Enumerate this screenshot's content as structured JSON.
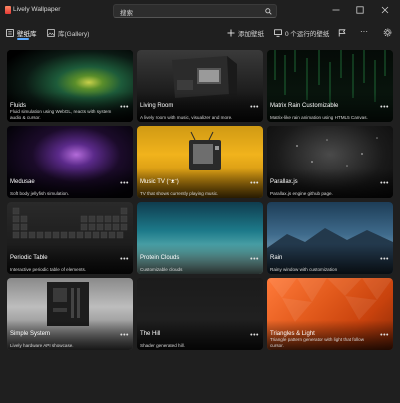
{
  "app": {
    "title": "Lively Wallpaper"
  },
  "search": {
    "value": "搜索"
  },
  "toolbar": {
    "tabs": [
      {
        "label": "壁纸库"
      },
      {
        "label": "库(Gallery)"
      }
    ],
    "add_label": "添加壁纸",
    "active_label": "0 个运行的壁纸"
  },
  "wallpapers": [
    {
      "title": "Fluids",
      "description": "Fluid simulation using WebGL, reacts with system audio & cursor.",
      "more": "•••"
    },
    {
      "title": "Living Room",
      "description": "A lively room with music, visualizer and more.",
      "more": "•••"
    },
    {
      "title": "Matrix Rain Customizable",
      "description": "Matrix-like rain animation using HTML5 Canvas.",
      "more": "•••"
    },
    {
      "title": "Medusae",
      "description": "Soft body jellyfish simulation.",
      "more": "•••"
    },
    {
      "title": "Music TV (ᵔᴥᵔ)",
      "description": "TV that shows currently playing music.",
      "more": "•••"
    },
    {
      "title": "Parallax.js",
      "description": "Parallax.js engine github page.",
      "more": "•••"
    },
    {
      "title": "Periodic Table",
      "description": "Interactive periodic table of elements.",
      "more": "•••"
    },
    {
      "title": "Protein Clouds",
      "description": "Customizable clouds",
      "more": "•••"
    },
    {
      "title": "Rain",
      "description": "Rainy window with customization",
      "more": "•••"
    },
    {
      "title": "Simple System",
      "description": "Lively hardware API showcase.",
      "more": "•••"
    },
    {
      "title": "The Hill",
      "description": "Shader generated hill.",
      "more": "•••"
    },
    {
      "title": "Triangles & Light",
      "description": "Triangle pattern generator with light that follow cursor.",
      "more": "•••"
    }
  ]
}
